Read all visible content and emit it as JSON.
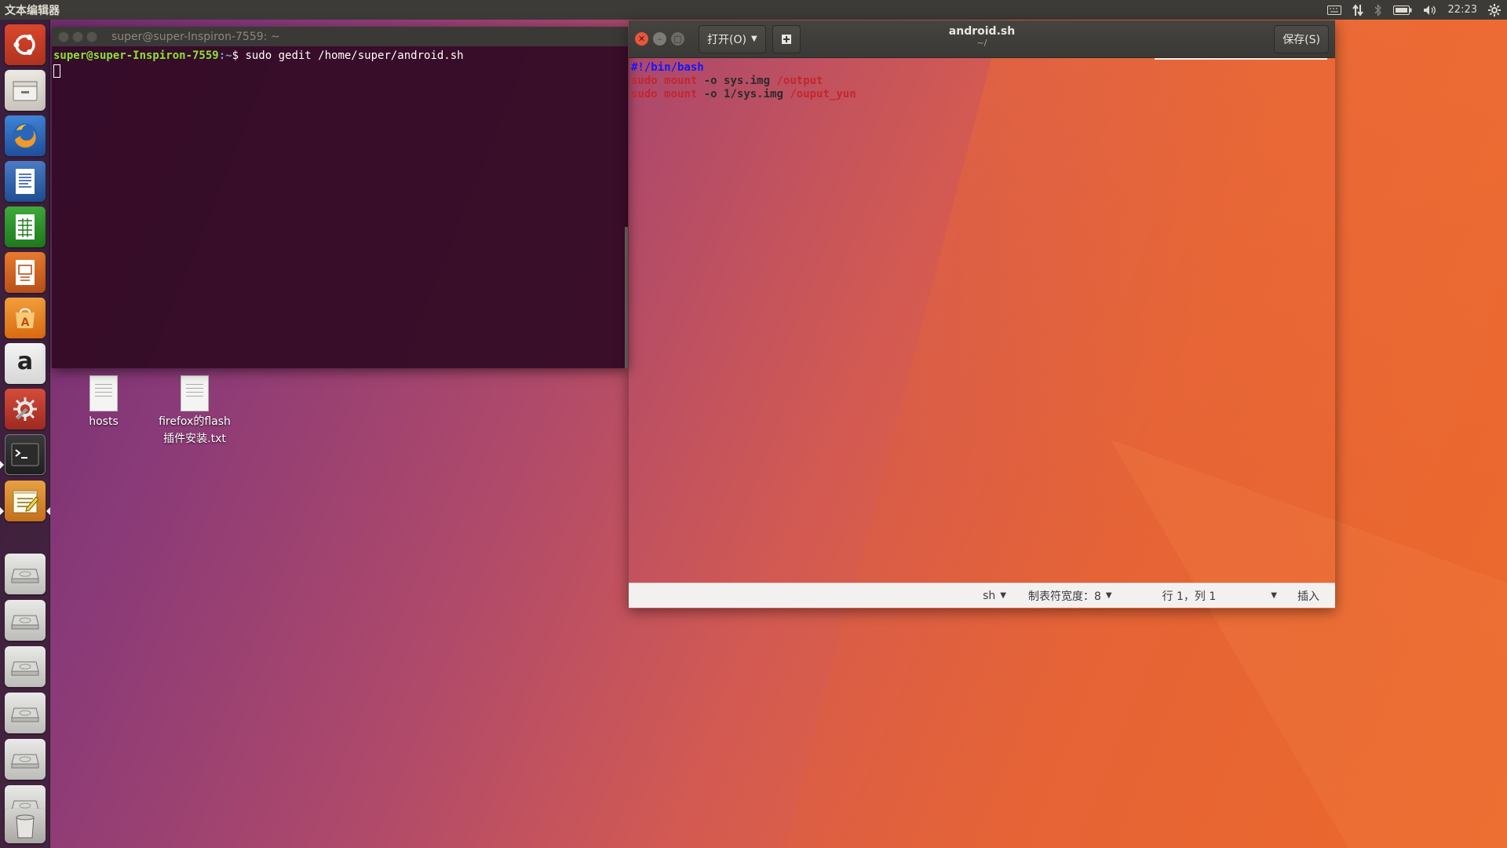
{
  "top_panel": {
    "app_title": "文本编辑器",
    "time": "22:23"
  },
  "launcher": {
    "items": [
      {
        "name": "ubuntu-dash-icon"
      },
      {
        "name": "files-icon"
      },
      {
        "name": "firefox-icon"
      },
      {
        "name": "libreoffice-writer-icon"
      },
      {
        "name": "libreoffice-calc-icon"
      },
      {
        "name": "libreoffice-impress-icon"
      },
      {
        "name": "software-center-icon"
      },
      {
        "name": "amazon-icon"
      },
      {
        "name": "system-settings-icon"
      },
      {
        "name": "terminal-icon"
      },
      {
        "name": "text-editor-icon"
      },
      {
        "name": "drive-icon"
      },
      {
        "name": "drive-icon"
      },
      {
        "name": "drive-icon"
      },
      {
        "name": "drive-icon"
      },
      {
        "name": "drive-icon"
      },
      {
        "name": "drive-icon"
      },
      {
        "name": "trash-icon"
      }
    ],
    "amazon_glyph": "a"
  },
  "desktop": {
    "icons": [
      {
        "label": "hosts"
      },
      {
        "label": "firefox的flash插件安装.txt"
      }
    ]
  },
  "terminal": {
    "title": "super@super-Inspiron-7559: ~",
    "prompt_user": "super@super-Inspiron-7559",
    "prompt_path": ":~",
    "prompt_symbol": "$",
    "command": " sudo gedit /home/super/android.sh"
  },
  "gedit": {
    "title": "android.sh",
    "subtitle": "~/",
    "open_label": "打开(O)",
    "save_label": "保存(S)",
    "lines": [
      {
        "shebang": "#!/bin/bash"
      },
      {
        "cmd1": "sudo",
        "cmd2": "mount",
        "args": "-o sys.img",
        "path": "/output"
      },
      {
        "cmd1": "sudo",
        "cmd2": "mount",
        "args": "-o 1/sys.img",
        "path": "/ouput_yun"
      }
    ],
    "status": {
      "language": "sh",
      "tab_width": "制表符宽度：8",
      "position": "行 1，列 1",
      "mode": "插入"
    }
  },
  "colors": {
    "terminal_bg": "#300a24",
    "prompt_green": "#8ae234",
    "prompt_blue": "#729fcf",
    "shebang_blue": "#1515ff",
    "keyword_red": "#c4262d"
  }
}
